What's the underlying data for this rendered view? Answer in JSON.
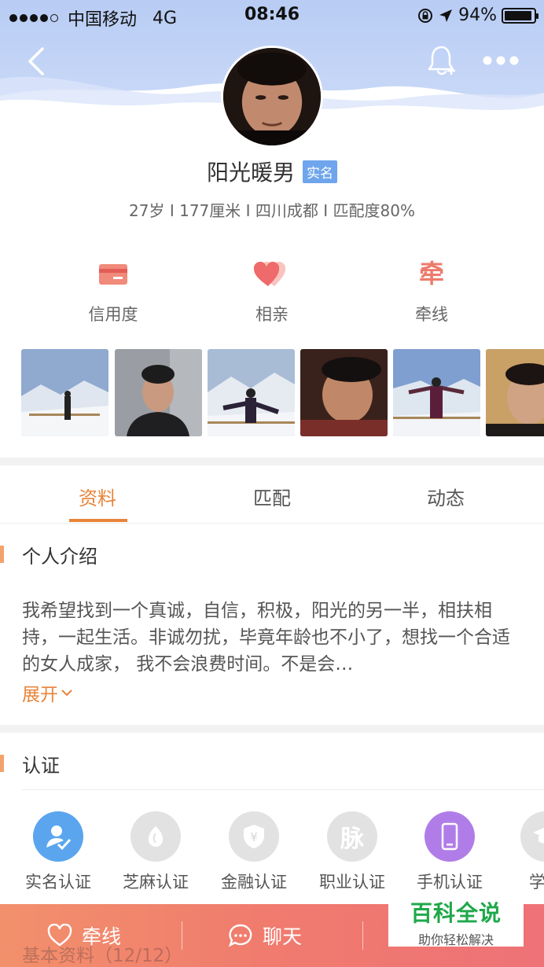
{
  "status_bar": {
    "carrier": "中国移动",
    "network": "4G",
    "time": "08:46",
    "battery": "94%",
    "battery_level": 0.94
  },
  "profile": {
    "name": "阳光暖男",
    "badge": "实名",
    "info": "27岁 I 177厘米 I 四川成都 I 匹配度80%"
  },
  "actions": [
    {
      "label": "信用度",
      "icon": "credit-card-icon"
    },
    {
      "label": "相亲",
      "icon": "hearts-icon"
    },
    {
      "label": "牵线",
      "icon": "qian-glyph-icon",
      "glyph": "牵"
    }
  ],
  "photos_count": 6,
  "tabs": [
    {
      "label": "资料",
      "active": true
    },
    {
      "label": "匹配",
      "active": false
    },
    {
      "label": "动态",
      "active": false
    }
  ],
  "intro": {
    "title": "个人介绍",
    "text": "我希望找到一个真诚，自信，积极，阳光的另一半，相扶相持，一起生活。非诚勿扰，毕竟年龄也不小了，想找一个合适的女人成家， 我不会浪费时间。不是会…",
    "expand": "展开"
  },
  "certification": {
    "title": "认证",
    "items": [
      {
        "label": "实名认证",
        "icon": "id-verified-icon",
        "color": "#5aa5ee",
        "active": true
      },
      {
        "label": "芝麻认证",
        "icon": "sesame-icon",
        "color": "#e2e2e2",
        "active": false
      },
      {
        "label": "金融认证",
        "icon": "shield-yen-icon",
        "color": "#e2e2e2",
        "active": false,
        "glyph": "¥"
      },
      {
        "label": "职业认证",
        "icon": "job-glyph-icon",
        "color": "#e2e2e2",
        "active": false,
        "glyph": "脉"
      },
      {
        "label": "手机认证",
        "icon": "phone-icon",
        "color": "#b07de8",
        "active": true
      },
      {
        "label": "学历",
        "icon": "graduation-cap-icon",
        "color": "#e2e2e2",
        "active": false
      }
    ]
  },
  "bottom_bar": {
    "items": [
      {
        "label": "牵线",
        "icon": "heart-outline-icon"
      },
      {
        "label": "聊天",
        "icon": "chat-bubble-icon"
      }
    ],
    "under_text": "基本资料（12/12）"
  },
  "watermark": {
    "title": "百科全说",
    "subtitle": "助你轻松解决"
  },
  "colors": {
    "accent": "#e8843a",
    "header_blue": "#b9cdf4",
    "badge_blue": "#6ea5ec",
    "bottom_gradient_start": "#f2906c",
    "bottom_gradient_end": "#ee7277"
  }
}
